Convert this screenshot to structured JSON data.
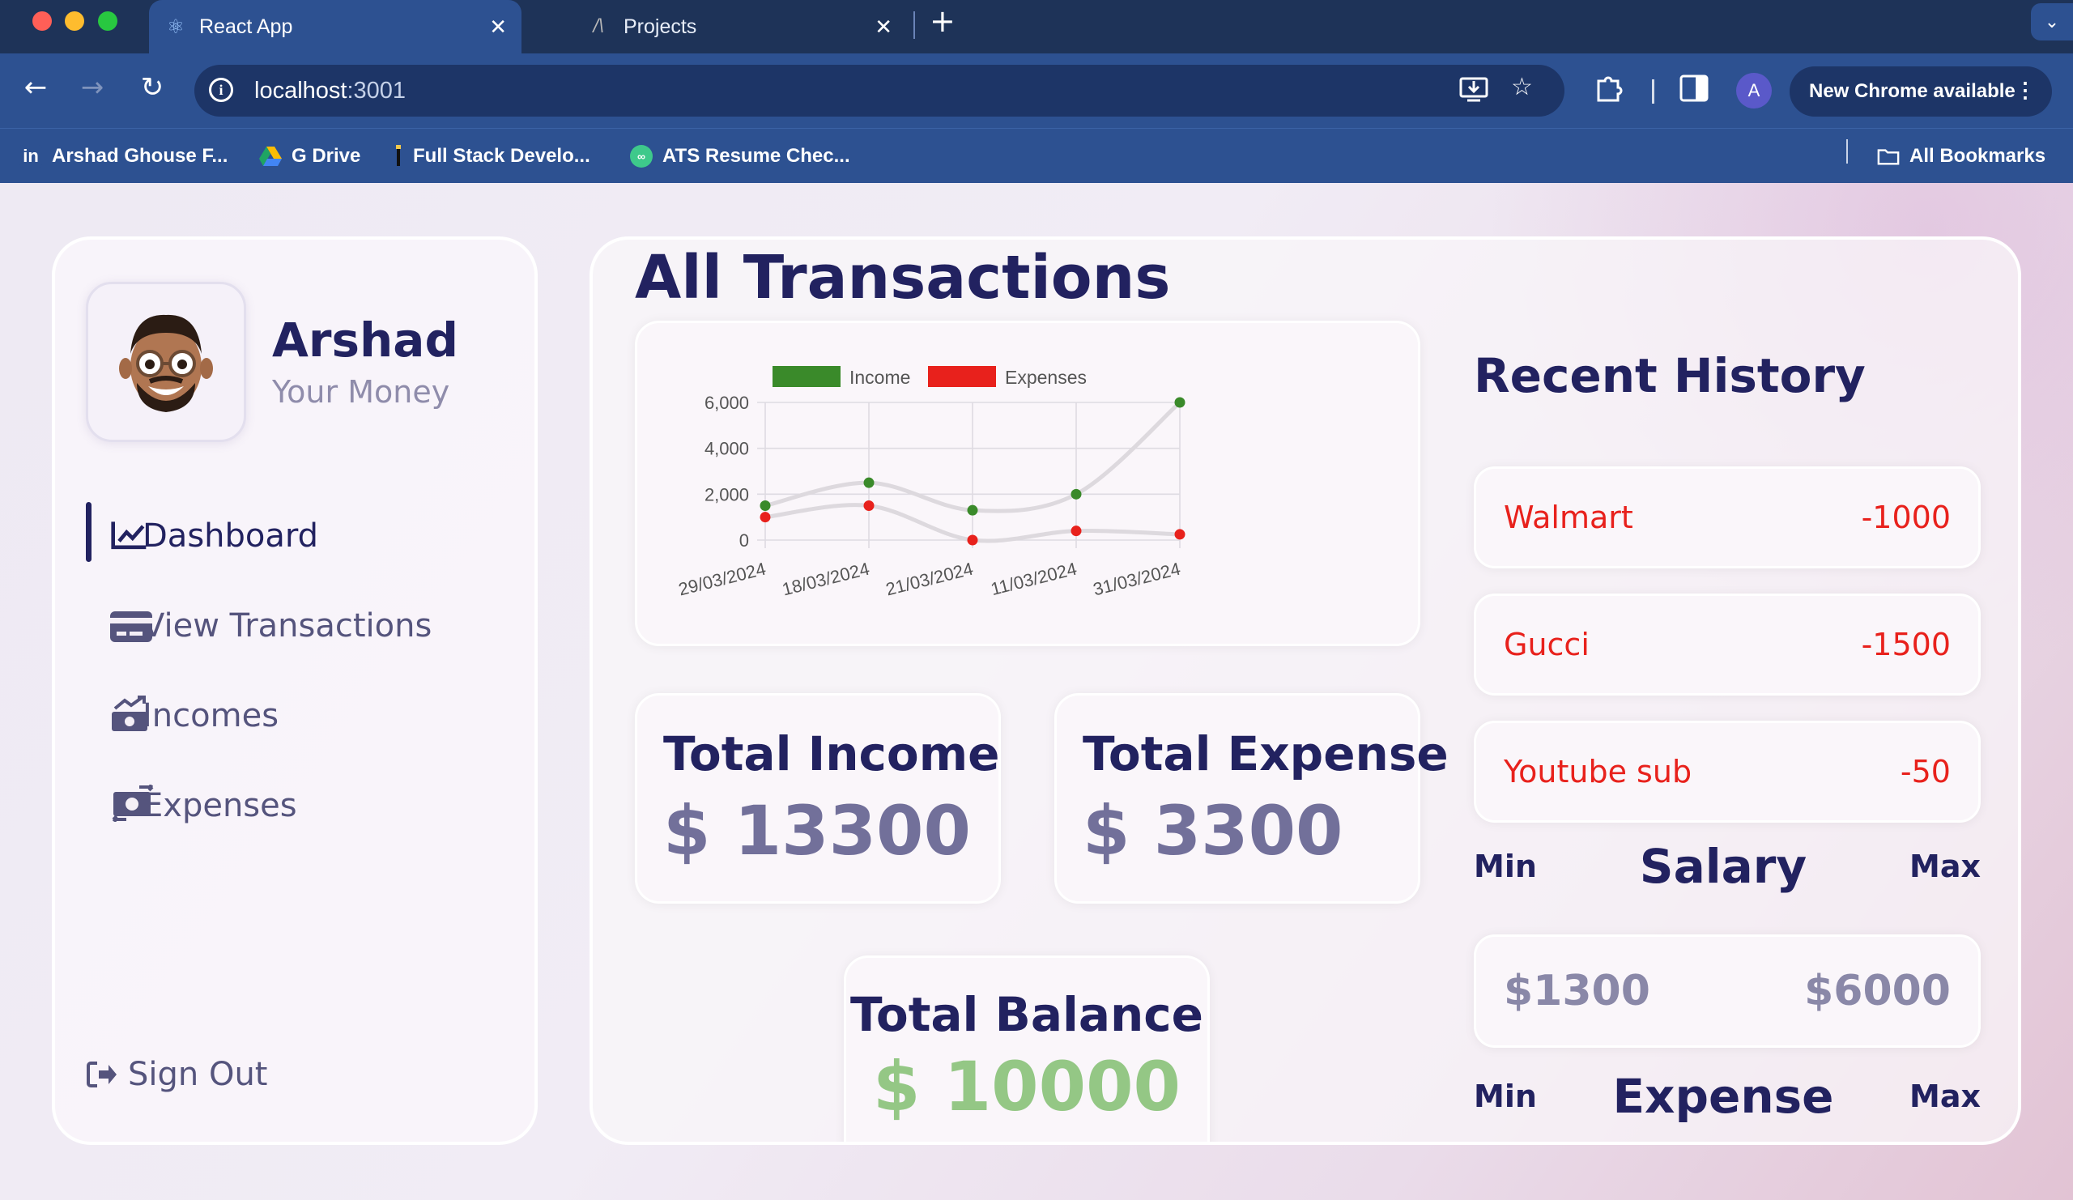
{
  "browser": {
    "tabs": [
      {
        "title": "React App",
        "icon": "react-icon",
        "active": true
      },
      {
        "title": "Projects",
        "icon": "vercel-icon",
        "active": false
      }
    ],
    "url_host": "localhost",
    "url_port": ":3001",
    "update_button": "New Chrome available",
    "profile_initial": "A",
    "bookmarks": [
      {
        "label": "Arshad Ghouse F...",
        "icon": "linkedin-icon"
      },
      {
        "label": "G Drive",
        "icon": "google-drive-icon"
      },
      {
        "label": "Full Stack Develo...",
        "icon": "bookmark-icon"
      },
      {
        "label": "ATS Resume Chec...",
        "icon": "ats-icon"
      }
    ],
    "all_bookmarks": "All Bookmarks"
  },
  "profile": {
    "name": "Arshad",
    "subtitle": "Your Money"
  },
  "menu": [
    {
      "label": "Dashboard",
      "icon": "chart-line-icon",
      "active": true
    },
    {
      "label": "View Transactions",
      "icon": "credit-card-icon",
      "active": false
    },
    {
      "label": "Incomes",
      "icon": "money-bill-trend-icon",
      "active": false
    },
    {
      "label": "Expenses",
      "icon": "money-bill-transfer-icon",
      "active": false
    }
  ],
  "signout": "Sign Out",
  "page_title": "All Transactions",
  "chart_data": {
    "type": "line",
    "categories": [
      "29/03/2024",
      "18/03/2024",
      "21/03/2024",
      "11/03/2024",
      "31/03/2024"
    ],
    "series": [
      {
        "name": "Income",
        "values": [
          1500,
          2500,
          1300,
          2000,
          6000
        ],
        "color": "#3a8a2a"
      },
      {
        "name": "Expenses",
        "values": [
          1000,
          1500,
          0,
          400,
          250
        ],
        "color": "#e8211c"
      }
    ],
    "y_ticks": [
      "0",
      "2,000",
      "4,000",
      "6,000"
    ],
    "ylim": [
      0,
      6000
    ],
    "legend": "top",
    "grid": true
  },
  "totals": {
    "income_title": "Total Income",
    "income_value": "$ 13300",
    "expense_title": "Total Expense",
    "expense_value": "$ 3300",
    "balance_title": "Total Balance",
    "balance_value": "$ 10000"
  },
  "history": {
    "title": "Recent History",
    "items": [
      {
        "name": "Walmart",
        "amount": "-1000"
      },
      {
        "name": "Gucci",
        "amount": "-1500"
      },
      {
        "name": "Youtube sub",
        "amount": "-50"
      }
    ]
  },
  "salary": {
    "min_label": "Min",
    "title": "Salary",
    "max_label": "Max",
    "min_value": "$1300",
    "max_value": "$6000"
  },
  "expense_range": {
    "min_label": "Min",
    "title": "Expense",
    "max_label": "Max"
  },
  "colors": {
    "navy": "#222260",
    "income": "#3a8a2a",
    "expense": "#e8211c",
    "balance": "#94c785"
  }
}
